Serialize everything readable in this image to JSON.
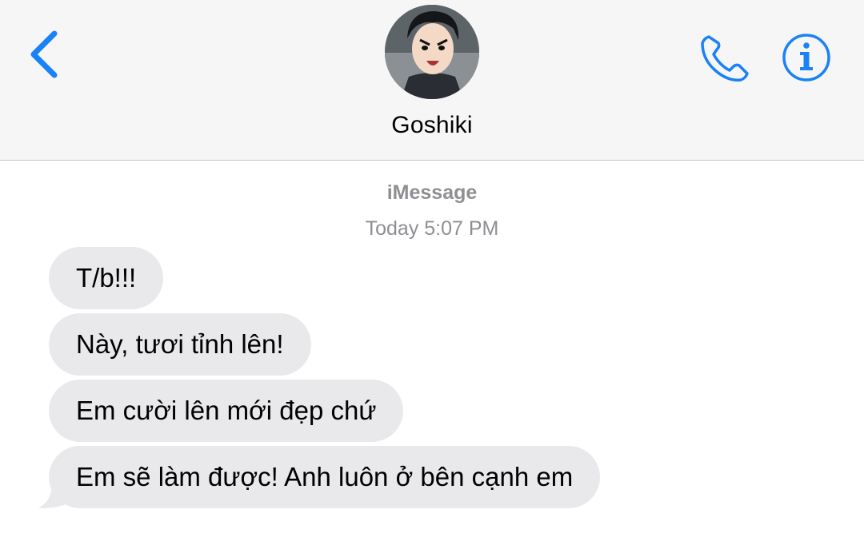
{
  "header": {
    "contact_name": "Goshiki",
    "back_icon": "chevron-left-icon",
    "call_icon": "phone-icon",
    "info_icon": "info-icon"
  },
  "thread": {
    "service": "iMessage",
    "timestamp": "Today 5:07 PM",
    "messages": [
      {
        "text": "T/b!!!"
      },
      {
        "text": "Này, tươi tỉnh lên!"
      },
      {
        "text": "Em cười lên mới đẹp chứ"
      },
      {
        "text": "Em sẽ làm được! Anh luôn ở bên cạnh em"
      }
    ]
  },
  "colors": {
    "accent": "#1a82f7",
    "bubble_incoming": "#e9e9eb",
    "header_bg": "#f6f6f6",
    "meta_text": "#8e8e93"
  }
}
